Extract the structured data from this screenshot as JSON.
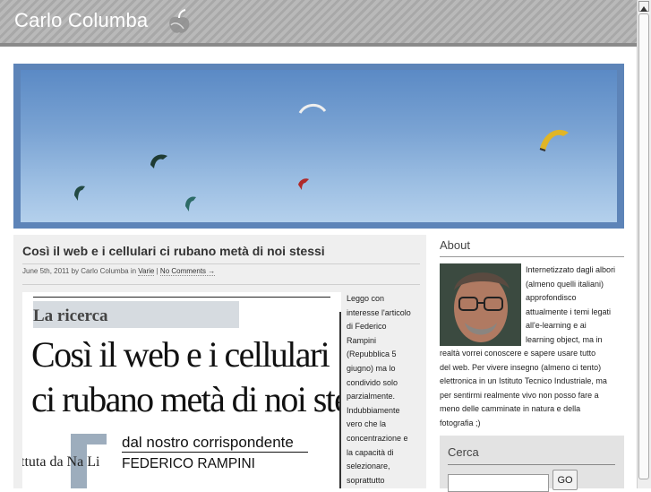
{
  "header": {
    "site_title": "Carlo Columba",
    "logo_icon": "apple-logo-icon"
  },
  "post": {
    "title": "Così il web e i cellulari ci rubano metà di noi stessi",
    "meta_date_by": "June 5th, 2011 by Carlo Columba in",
    "meta_category": "Varie",
    "meta_separator": "|",
    "meta_comments": "No Comments →",
    "clipping": {
      "label": "La ricerca",
      "headline_line1": "Così il web e i cellulari",
      "headline_line2": "ci rubano metà di noi stessi",
      "side_text": "ttuta da Na Li",
      "subline1": "dal nostro corrispondente",
      "subline2": "FEDERICO RAMPINI"
    },
    "text_lines": [
      "Leggo con",
      "interesse l'articolo",
      "di Federico",
      "Rampini",
      "(Repubblica 5",
      "giugno) ma lo",
      "condivido solo",
      "parzialmente.",
      "Indubbiamente",
      "vero che la",
      "concentrazione e",
      "la capacità di",
      "selezionare,",
      "soprattutto"
    ]
  },
  "sidebar": {
    "about_title": "About",
    "about_lines_a": [
      "Internetizzato dagli albori",
      "(almeno quelli italiani)",
      "approfondisco",
      "attualmente i temi legati",
      "all'e-learning e ai",
      "learning object, ma in"
    ],
    "about_lines_b": [
      "realtà vorrei conoscere e sapere usare tutto",
      "del web. Per vivere insegno (almeno ci tento)",
      "elettronica in un Istituto Tecnico Industriale, ma",
      "per sentirmi realmente vivo non posso fare a",
      "meno delle camminate in natura e della",
      "fotografia ;)"
    ],
    "search_title": "Cerca",
    "search_value": "",
    "search_button": "GO"
  },
  "colors": {
    "header_stripe_a": "#a8a8a8",
    "header_stripe_b": "#b9b9b9",
    "banner_frame": "#5d84b8",
    "content_bg": "#efefef"
  }
}
